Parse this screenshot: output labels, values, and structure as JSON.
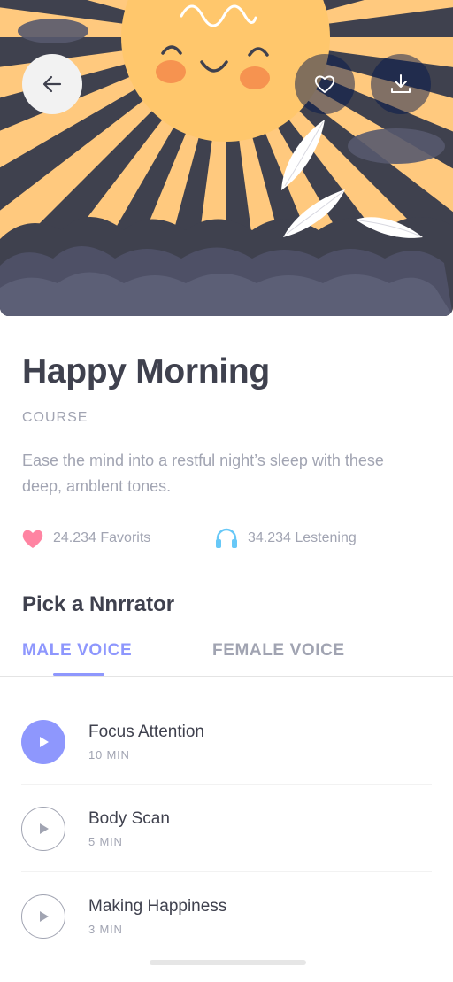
{
  "hero": {
    "colors": {
      "background": "#3F414E",
      "rays": "#FFC97E",
      "sun": "#FFC76C",
      "clouds": "#5C5F76"
    },
    "illustration": "smiling-sun-with-rays-clouds-and-feathers"
  },
  "header": {
    "back_icon": "arrow-left-icon",
    "favorite_icon": "heart-outline-icon",
    "download_icon": "download-icon"
  },
  "course": {
    "title": "Happy Morning",
    "type": "COURSE",
    "description": "Ease the mind into a restful night’s sleep  with these deep, amblent tones."
  },
  "stats": {
    "favorites": "24.234 Favorits",
    "listening": "34.234 Lestening",
    "favorite_icon": "heart-filled-icon",
    "listening_icon": "headphones-icon"
  },
  "narrator": {
    "heading": "Pick a Nnrrator",
    "tabs": [
      {
        "label": "MALE VOICE",
        "active": true
      },
      {
        "label": "FEMALE VOICE",
        "active": false
      }
    ]
  },
  "tracks": [
    {
      "title": "Focus Attention",
      "duration": "10 MIN",
      "playing": true
    },
    {
      "title": "Body Scan",
      "duration": "5 MIN",
      "playing": false
    },
    {
      "title": "Making Happiness",
      "duration": "3 MIN",
      "playing": false
    }
  ],
  "theme": {
    "accent": "#8E97FD",
    "text": "#3F414E",
    "muted": "#A1A4B2",
    "heart": "#FF84A2",
    "headphones": "#67C8F7"
  }
}
